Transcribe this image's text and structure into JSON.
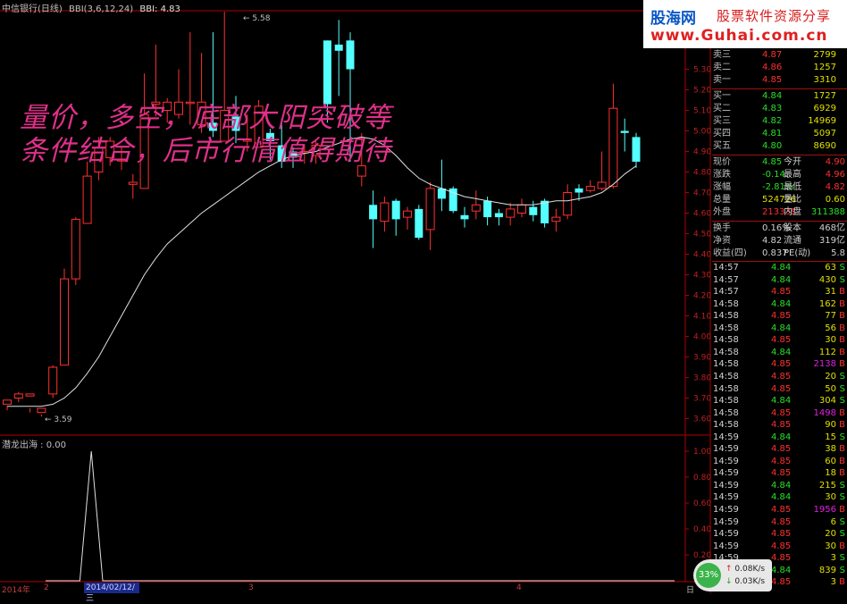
{
  "header": {
    "stock_name": "中信银行(日线)",
    "bbi_params": "BBI(3,6,12,24)",
    "bbi_value": "BBI: 4.83"
  },
  "overlay_text": {
    "line1": "量价，多空，底部大阳突破等",
    "line2": "条件结合，后市行情值得期待"
  },
  "indicator": {
    "title": "潜龙出海 : 0.00",
    "axis": [
      "1.00",
      "0.80",
      "0.60",
      "0.40",
      "0.20"
    ]
  },
  "price_axis": [
    "5.30",
    "5.20",
    "5.10",
    "5.00",
    "4.90",
    "4.80",
    "4.70",
    "4.60",
    "4.50",
    "4.40",
    "4.30",
    "4.20",
    "4.10",
    "4.00",
    "3.90",
    "3.80",
    "3.70",
    "3.60"
  ],
  "annotations": {
    "high": "5.58",
    "low": "3.59"
  },
  "dates": {
    "year": "2014年",
    "m2": "2",
    "selected": "2014/02/12/三",
    "m3": "3",
    "m4": "4",
    "corner": "日"
  },
  "logo": {
    "site": "股海网",
    "slogan": "股票软件资源分享",
    "url": "www.Guhai.com.cn"
  },
  "colors": {
    "up": "#ff3030",
    "down": "#54ffff",
    "ma": "#e0e0e0",
    "overlay": "#e0308a"
  },
  "order_book": {
    "sell": [
      {
        "label": "卖三",
        "price": "4.87",
        "vol": "2799"
      },
      {
        "label": "卖二",
        "price": "4.86",
        "vol": "1257"
      },
      {
        "label": "卖一",
        "price": "4.85",
        "vol": "3310"
      }
    ],
    "buy": [
      {
        "label": "买一",
        "price": "4.84",
        "vol": "1727"
      },
      {
        "label": "买二",
        "price": "4.83",
        "vol": "6929"
      },
      {
        "label": "买三",
        "price": "4.82",
        "vol": "14969"
      },
      {
        "label": "买四",
        "price": "4.81",
        "vol": "5097"
      },
      {
        "label": "买五",
        "price": "4.80",
        "vol": "8690"
      }
    ]
  },
  "quote": [
    {
      "l1": "现价",
      "v1": "4.85",
      "l2": "今开",
      "v2": "4.90"
    },
    {
      "l1": "涨跌",
      "v1": "-0.14",
      "l2": "最高",
      "v2": "4.96"
    },
    {
      "l1": "涨幅",
      "v1": "-2.81%",
      "l2": "最低",
      "v2": "4.82"
    },
    {
      "l1": "总量",
      "v1": "524726",
      "l2": "量比",
      "v2": "0.60"
    },
    {
      "l1": "外盘",
      "v1": "213338",
      "l2": "内盘",
      "v2": "311388"
    }
  ],
  "stats": [
    {
      "l1": "换手",
      "v1": "0.16%",
      "l2": "股本",
      "v2": "468亿"
    },
    {
      "l1": "净资",
      "v1": "4.82",
      "l2": "流通",
      "v2": "319亿"
    },
    {
      "l1": "收益(四)",
      "v1": "0.837",
      "l2": "PE(动)",
      "v2": "5.8"
    }
  ],
  "ticks": [
    {
      "t": "14:57",
      "p": "4.84",
      "v": "63",
      "s": "S"
    },
    {
      "t": "14:57",
      "p": "4.84",
      "v": "430",
      "s": "S"
    },
    {
      "t": "14:57",
      "p": "4.85",
      "v": "31",
      "s": "B"
    },
    {
      "t": "14:58",
      "p": "4.84",
      "v": "162",
      "s": "B"
    },
    {
      "t": "14:58",
      "p": "4.85",
      "v": "77",
      "s": "B"
    },
    {
      "t": "14:58",
      "p": "4.84",
      "v": "56",
      "s": "B"
    },
    {
      "t": "14:58",
      "p": "4.85",
      "v": "30",
      "s": "B"
    },
    {
      "t": "14:58",
      "p": "4.84",
      "v": "112",
      "s": "B"
    },
    {
      "t": "14:58",
      "p": "4.85",
      "v": "2138",
      "s": "B"
    },
    {
      "t": "14:58",
      "p": "4.85",
      "v": "20",
      "s": "S"
    },
    {
      "t": "14:58",
      "p": "4.85",
      "v": "50",
      "s": "S"
    },
    {
      "t": "14:58",
      "p": "4.84",
      "v": "304",
      "s": "S"
    },
    {
      "t": "14:58",
      "p": "4.85",
      "v": "1498",
      "s": "B"
    },
    {
      "t": "14:58",
      "p": "4.85",
      "v": "90",
      "s": "B"
    },
    {
      "t": "14:59",
      "p": "4.84",
      "v": "15",
      "s": "S"
    },
    {
      "t": "14:59",
      "p": "4.85",
      "v": "38",
      "s": "B"
    },
    {
      "t": "14:59",
      "p": "4.85",
      "v": "60",
      "s": "B"
    },
    {
      "t": "14:59",
      "p": "4.85",
      "v": "18",
      "s": "B"
    },
    {
      "t": "14:59",
      "p": "4.84",
      "v": "215",
      "s": "S"
    },
    {
      "t": "14:59",
      "p": "4.84",
      "v": "30",
      "s": "S"
    },
    {
      "t": "14:59",
      "p": "4.85",
      "v": "1956",
      "s": "B"
    },
    {
      "t": "14:59",
      "p": "4.85",
      "v": "6",
      "s": "S"
    },
    {
      "t": "14:59",
      "p": "4.85",
      "v": "20",
      "s": "S"
    },
    {
      "t": "14:59",
      "p": "4.85",
      "v": "30",
      "s": "B"
    },
    {
      "t": "14:59",
      "p": "4.85",
      "v": "3",
      "s": "S"
    },
    {
      "t": "14:59",
      "p": "4.84",
      "v": "839",
      "s": "S"
    },
    {
      "t": "14:59",
      "p": "4.85",
      "v": "3",
      "s": "B"
    }
  ],
  "speed_widget": {
    "percent": "33%",
    "up": "0.08K/s",
    "down": "0.03K/s"
  },
  "candles": [
    [
      3.67,
      3.69,
      3.64,
      3.66
    ],
    [
      3.7,
      3.72,
      3.68,
      3.73
    ],
    [
      3.71,
      3.72,
      3.63,
      3.65
    ],
    [
      3.63,
      3.65,
      3.61,
      3.62
    ],
    [
      3.72,
      3.85,
      3.7,
      3.86
    ],
    [
      3.86,
      4.28,
      3.86,
      4.33
    ],
    [
      4.28,
      4.57,
      4.25,
      4.58
    ],
    [
      4.55,
      4.78,
      4.55,
      4.85
    ],
    [
      4.8,
      4.92,
      4.76,
      4.97
    ],
    [
      4.87,
      4.95,
      4.83,
      4.97
    ],
    [
      4.86,
      4.86,
      4.81,
      4.92
    ],
    [
      4.74,
      4.75,
      4.67,
      4.79
    ],
    [
      4.72,
      5.08,
      4.72,
      5.28
    ],
    [
      5.13,
      5.14,
      5.07,
      5.42
    ],
    [
      5.1,
      5.14,
      5.04,
      5.16
    ],
    [
      5.08,
      5.14,
      5.06,
      5.3
    ],
    [
      5.14,
      5.14,
      5.03,
      5.48
    ],
    [
      5.03,
      5.14,
      4.99,
      5.38
    ],
    [
      5.04,
      5.0,
      4.97,
      5.48
    ],
    [
      4.95,
      5.1,
      4.95,
      5.58
    ],
    [
      5.07,
      5.0,
      4.94,
      5.17
    ],
    [
      4.95,
      4.96,
      4.9,
      5.08
    ],
    [
      4.92,
      5.12,
      4.92,
      5.15
    ],
    [
      4.99,
      4.95,
      4.86,
      5.01
    ],
    [
      4.93,
      4.85,
      4.82,
      5.06
    ],
    [
      4.9,
      4.87,
      4.82,
      4.92
    ],
    [
      4.9,
      4.9,
      4.84,
      4.93
    ],
    [
      4.88,
      4.93,
      4.84,
      4.95
    ],
    [
      5.44,
      5.13,
      5.04,
      5.44
    ],
    [
      5.42,
      5.39,
      5.17,
      5.54
    ],
    [
      5.44,
      5.3,
      4.85,
      5.48
    ],
    [
      4.78,
      4.83,
      4.73,
      4.99
    ],
    [
      4.64,
      4.57,
      4.43,
      4.71
    ],
    [
      4.56,
      4.65,
      4.51,
      4.68
    ],
    [
      4.66,
      4.57,
      4.49,
      4.67
    ],
    [
      4.58,
      4.61,
      4.52,
      4.63
    ],
    [
      4.62,
      4.48,
      4.47,
      4.64
    ],
    [
      4.52,
      4.72,
      4.42,
      4.75
    ],
    [
      4.72,
      4.67,
      4.61,
      4.86
    ],
    [
      4.72,
      4.61,
      4.6,
      4.73
    ],
    [
      4.59,
      4.57,
      4.53,
      4.63
    ],
    [
      4.61,
      4.64,
      4.57,
      4.71
    ],
    [
      4.66,
      4.58,
      4.54,
      4.68
    ],
    [
      4.6,
      4.58,
      4.54,
      4.62
    ],
    [
      4.58,
      4.62,
      4.54,
      4.65
    ],
    [
      4.6,
      4.64,
      4.58,
      4.67
    ],
    [
      4.63,
      4.59,
      4.56,
      4.66
    ],
    [
      4.66,
      4.55,
      4.53,
      4.67
    ],
    [
      4.56,
      4.58,
      4.51,
      4.62
    ],
    [
      4.59,
      4.7,
      4.57,
      4.74
    ],
    [
      4.72,
      4.7,
      4.66,
      4.74
    ],
    [
      4.71,
      4.73,
      4.7,
      4.76
    ],
    [
      4.72,
      4.75,
      4.71,
      4.9
    ],
    [
      4.73,
      5.11,
      4.72,
      5.23
    ],
    [
      5.0,
      4.99,
      4.9,
      5.06
    ],
    [
      4.97,
      4.85,
      4.82,
      4.99
    ]
  ],
  "bbi_line": [
    3.66,
    3.66,
    3.66,
    3.66,
    3.67,
    3.7,
    3.75,
    3.82,
    3.9,
    4.0,
    4.1,
    4.2,
    4.3,
    4.38,
    4.45,
    4.5,
    4.55,
    4.6,
    4.64,
    4.68,
    4.72,
    4.76,
    4.8,
    4.83,
    4.86,
    4.88,
    4.89,
    4.9,
    4.92,
    4.94,
    4.96,
    4.97,
    4.96,
    4.93,
    4.88,
    4.82,
    4.77,
    4.74,
    4.72,
    4.7,
    4.68,
    4.67,
    4.66,
    4.65,
    4.64,
    4.64,
    4.64,
    4.65,
    4.66,
    4.66,
    4.67,
    4.68,
    4.7,
    4.74,
    4.79,
    4.83
  ],
  "indicator_values": [
    0,
    0,
    0,
    0,
    1,
    0,
    0,
    0,
    0,
    0,
    0,
    0,
    0,
    0,
    0,
    0,
    0,
    0,
    0,
    0,
    0,
    0,
    0,
    0,
    0,
    0,
    0,
    0,
    0,
    0,
    0,
    0,
    0,
    0,
    0,
    0,
    0,
    0,
    0,
    0,
    0,
    0,
    0,
    0,
    0,
    0,
    0,
    0,
    0,
    0,
    0,
    0,
    0,
    0,
    0,
    0
  ]
}
